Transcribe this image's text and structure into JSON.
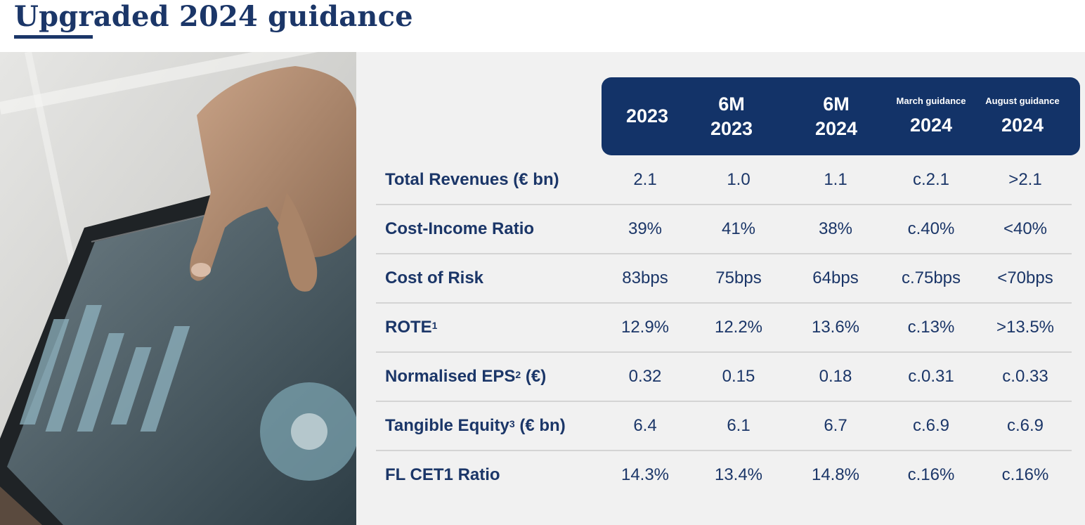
{
  "page": {
    "title": "Upgraded 2024 guidance"
  },
  "table": {
    "columns": [
      {
        "label": "",
        "year": "2023"
      },
      {
        "label": "6M",
        "year": "2023"
      },
      {
        "label": "6M",
        "year": "2024"
      },
      {
        "label": "March guidance",
        "year": "2024"
      },
      {
        "label": "August guidance",
        "year": "2024"
      }
    ],
    "rows": [
      {
        "label": "Total Revenues (€ bn)",
        "label_main": "Total Revenues (€ bn)",
        "sup": "",
        "label_tail": "",
        "values": [
          "2.1",
          "1.0",
          "1.1",
          "c.2.1",
          ">2.1"
        ]
      },
      {
        "label": "Cost-Income Ratio",
        "label_main": "Cost-Income Ratio",
        "sup": "",
        "label_tail": "",
        "values": [
          "39%",
          "41%",
          "38%",
          "c.40%",
          "<40%"
        ]
      },
      {
        "label": "Cost of Risk",
        "label_main": "Cost of Risk",
        "sup": "",
        "label_tail": "",
        "values": [
          "83bps",
          "75bps",
          "64bps",
          "c.75bps",
          "<70bps"
        ]
      },
      {
        "label": "ROTE1",
        "label_main": "ROTE",
        "sup": "1",
        "label_tail": "",
        "values": [
          "12.9%",
          "12.2%",
          "13.6%",
          "c.13%",
          ">13.5%"
        ]
      },
      {
        "label": "Normalised EPS2 (€)",
        "label_main": "Normalised EPS",
        "sup": "2",
        "label_tail": " (€)",
        "values": [
          "0.32",
          "0.15",
          "0.18",
          "c.0.31",
          "c.0.33"
        ]
      },
      {
        "label": "Tangible Equity3 (€ bn)",
        "label_main": "Tangible Equity",
        "sup": "3",
        "label_tail": " (€ bn)",
        "values": [
          "6.4",
          "6.1",
          "6.7",
          "c.6.9",
          "c.6.9"
        ]
      },
      {
        "label": "FL CET1 Ratio",
        "label_main": "FL CET1 Ratio",
        "sup": "",
        "label_tail": "",
        "values": [
          "14.3%",
          "13.4%",
          "14.8%",
          "c.16%",
          "c.16%"
        ]
      }
    ]
  },
  "colors": {
    "brand_navy": "#133368",
    "text_navy": "#1b3668",
    "panel_bg": "#f1f1f1",
    "separator": "#d4d4d4"
  },
  "icons": {
    "photo": "hand-touching-tablet-photo"
  }
}
